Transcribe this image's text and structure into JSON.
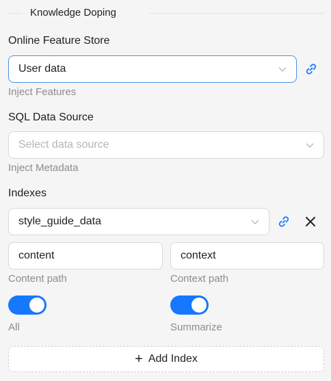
{
  "section": {
    "title": "Knowledge Doping"
  },
  "feature_store": {
    "label": "Online Feature Store",
    "value": "User data",
    "help": "Inject Features"
  },
  "sql_source": {
    "label": "SQL Data Source",
    "placeholder": "Select data source",
    "help": "Inject Metadata"
  },
  "indexes": {
    "label": "Indexes",
    "value": "style_guide_data",
    "content_value": "content",
    "content_help": "Content path",
    "context_value": "context",
    "context_help": "Context path",
    "toggle_all_label": "All",
    "toggle_all_on": true,
    "toggle_summarize_label": "Summarize",
    "toggle_summarize_on": true,
    "remove_label": "X"
  },
  "add_index": {
    "label": "Add Index",
    "icon": "plus-icon"
  },
  "colors": {
    "accent": "#1677ff",
    "link": "#1677ff",
    "focus_border": "#4a90e2"
  }
}
